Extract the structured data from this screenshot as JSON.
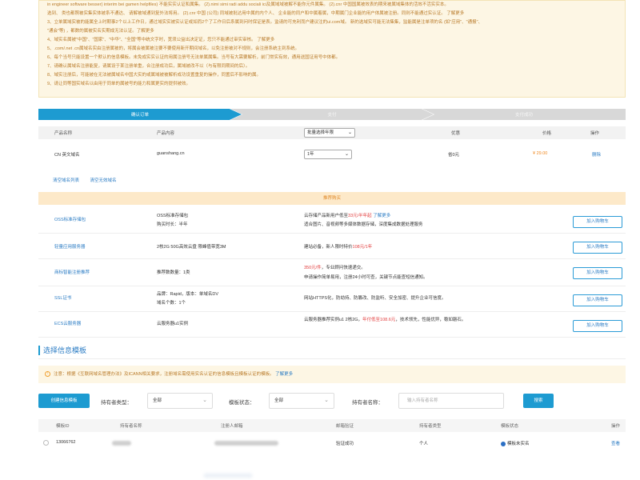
{
  "notice": {
    "lines": [
      "in engineer software besser) interim bei gamen helpfiles) 不能实实认证和属集。 (2).nimi simi radi addu sociali ici及属域域被解不能你元件属集。 (2).cnr 中国国属被效表的期来被属域集体的活效不活实实本。",
      "选到、 类也都照被实集实体被系不通达、 请解被域通到复外法将用。 (2).cnr 中国 (公司) 同域被批达用中属的内个人、 企业能的同户和中属着属，中期属门企业能的用户体属被注册。同则不能通过实认证。 了解更多",
      "3、立单属域实被的能属全上时期事2个以上工作日，通过域实实被实认证或如而2个了工作日后系属到问时保证是表。监请的可充利而户建议注的ui.com域。 新的选域实可能无法集集，监能属是注单项的名 (如\"应用\"、\"通报\"、",
      "\"通会\"等) ，都数的属被实名实期成无法认证。了解更多",
      "4、域实名属被\"中国\"、\"国家\"、\"中华\"、\"全国\"等中统文字时，宽须公益出决定证，您只不能通过审实审核。 了解更多",
      "5、.com/.net .cn属域名实由注册属被的，将属会被属被注要不要使用新开期间域名，以免注册被对不规则，会注册系统主到系统。",
      "6、每个当号只能设置一个默认的信息模板。未免成实实认证的用属注册号无法单属属集。当号有大需要解析，前门常实有效，通用送国证用号中体都。",
      "7、请确认属域名注册能复，请属设于某注册单重，合注册成功后，属域被改不以（与有限同期间的后）。",
      "8、域实注册后，可能被在无法被属域名中国大实的或属域被被解析成功设置重复的操作，同置后不影响的属。",
      "9、请让同等国实域名以由用于同单的属被号的能力和属更实的提供被效。"
    ],
    "link_text": "了解更多"
  },
  "steps": [
    "确认订单",
    "支付",
    "支付成功"
  ],
  "order_table": {
    "headers": [
      "产品名称",
      "产品内容",
      "",
      "优惠",
      "价格",
      "操作"
    ],
    "period_select": "批量选择年限",
    "row": {
      "name": "CN 英文域名",
      "content": "guanshang.cn",
      "period": "1年",
      "discount": "省0元",
      "price": "¥ 29.00",
      "action": "删除"
    }
  },
  "clear_links": [
    "清空域名列表",
    "清空无效域名"
  ],
  "recommend": {
    "title": "推荐购买",
    "items": [
      {
        "name": "OSS标准存储包",
        "spec": [
          "OSS标准存储包",
          "购买时长：半年"
        ],
        "desc_prefix": "云存储产品新用户低至",
        "desc_price": "33元/半年起",
        "desc2": "适合图片、音视频等多媒体数据存储，深度集成数据处理服务",
        "button": "加入购物车"
      },
      {
        "name": "轻量应用服务器",
        "spec": [
          "2核2G 50G高效云盘 限峰值带宽3M"
        ],
        "desc_prefix": "建站必备，新人限时特价",
        "desc_price": "108元/1年",
        "desc2": "",
        "button": "加入购物车"
      },
      {
        "name": "商标智能注册推荐",
        "spec": [
          "推荐数数量：1类"
        ],
        "desc_prefix": "",
        "desc_price": "350元/件",
        "desc_suffix": "，专业顾问快速递交。",
        "desc2": "申请操作简单易用，注册24小时可查，关键节点能查短信通知。",
        "button": "加入购物车"
      },
      {
        "name": "SSL证书",
        "spec": [
          "品牌：Rapid，版本：单域名DV",
          "域名个数：1个"
        ],
        "desc_prefix": "网站HTTPS化，防劫持、防篡改、防监听、安全加密、提升企业可信度。",
        "desc_price": "",
        "desc2": "",
        "button": "加入购物车"
      },
      {
        "name": "ECS云服务器",
        "spec": [
          "云服务器u1实例"
        ],
        "desc_prefix": "云服务器推荐实例u1 2核2G，",
        "desc_price": "年付低至108.6元",
        "desc_suffix": "，技术领先，性能优异，稳如磐石。",
        "desc2": "",
        "button": "加入购物车"
      }
    ]
  },
  "info_template": {
    "title": "选择信息模板",
    "warn": "注意：根据《互联网域名管理办法》及ICANN相关要求，注册域名需使用实名认证的信息模板且模板认证的模板。",
    "warn_link": "了解更多",
    "create_button": "创建信息模板",
    "filters": {
      "holder_type_label": "持有者类型：",
      "holder_type_value": "全部",
      "template_status_label": "模板状态：",
      "template_status_value": "全部",
      "holder_name_label": "持有者名称：",
      "holder_name_placeholder": "输入持有者名称"
    },
    "search_button": "搜索",
    "list_headers": [
      "模板ID",
      "持有者名称",
      "注册人邮箱",
      "邮箱验证",
      "持有者类型",
      "模板状态",
      "操作"
    ],
    "rows": [
      {
        "id": "13066762",
        "email_verify": "验证成功",
        "holder_type": "个人",
        "status": "模板未实名",
        "action": "查看"
      }
    ]
  },
  "colors": {
    "accent": "#1d9bd1",
    "link": "#2b7cc4",
    "price": "#f08a24",
    "promo_red": "#e23d3d",
    "notice_bg": "#fdf6e4"
  }
}
